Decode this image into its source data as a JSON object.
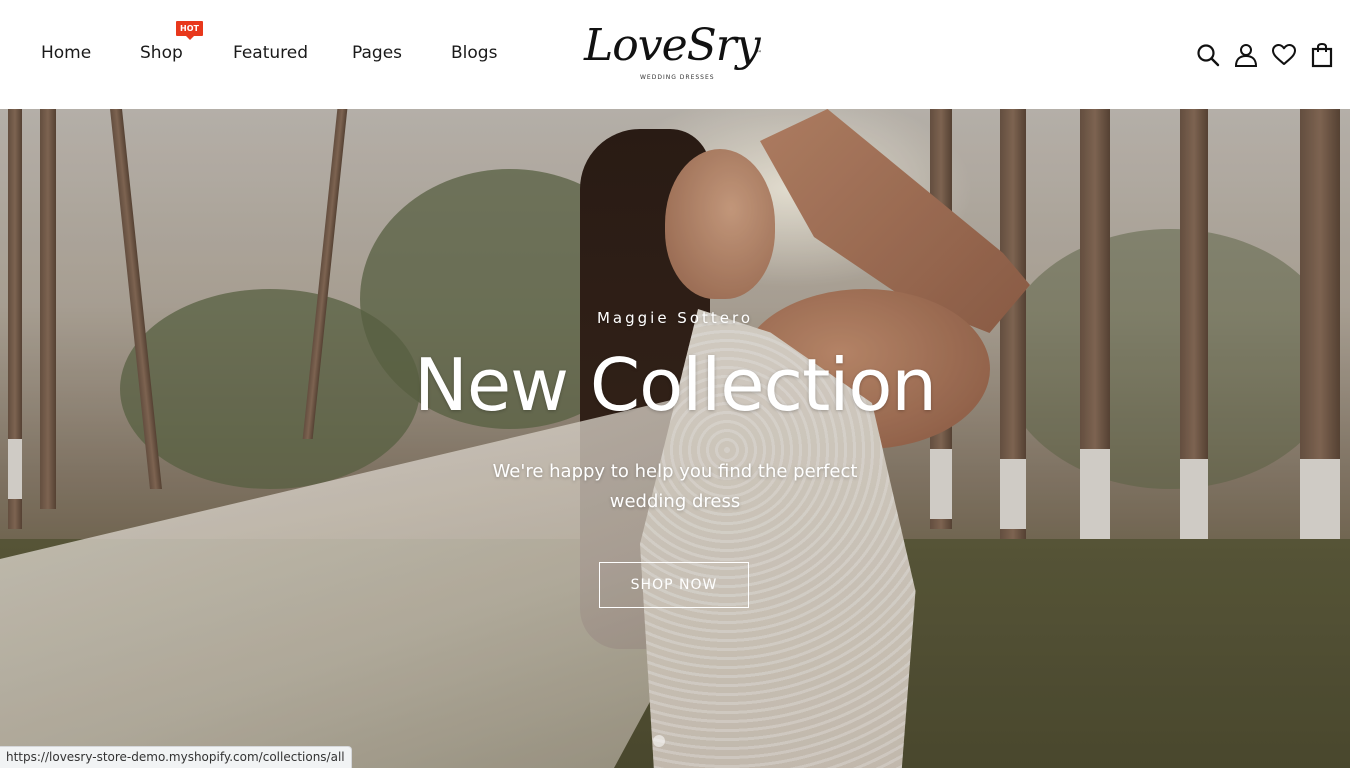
{
  "header": {
    "nav": [
      {
        "label": "Home"
      },
      {
        "label": "Shop",
        "badge": "HOT"
      },
      {
        "label": "Featured"
      },
      {
        "label": "Pages"
      },
      {
        "label": "Blogs"
      }
    ],
    "logo": {
      "script": "LoveSry",
      "tm": "™",
      "subtitle": "WEDDING DRESSES"
    },
    "icons": [
      "search-icon",
      "account-icon",
      "wishlist-heart-icon",
      "cart-bag-icon"
    ]
  },
  "hero": {
    "brand": "Maggie Sottero",
    "title": "New Collection",
    "description": "We're happy to help you find the perfect wedding dress",
    "button_label": "SHOP NOW",
    "slide_dots": 1
  },
  "status_bar": {
    "url": "https://lovesry-store-demo.myshopify.com/collections/all"
  },
  "colors": {
    "badge": "#e8381c",
    "text_dark": "#1a1a1a",
    "hero_text": "#ffffff"
  }
}
